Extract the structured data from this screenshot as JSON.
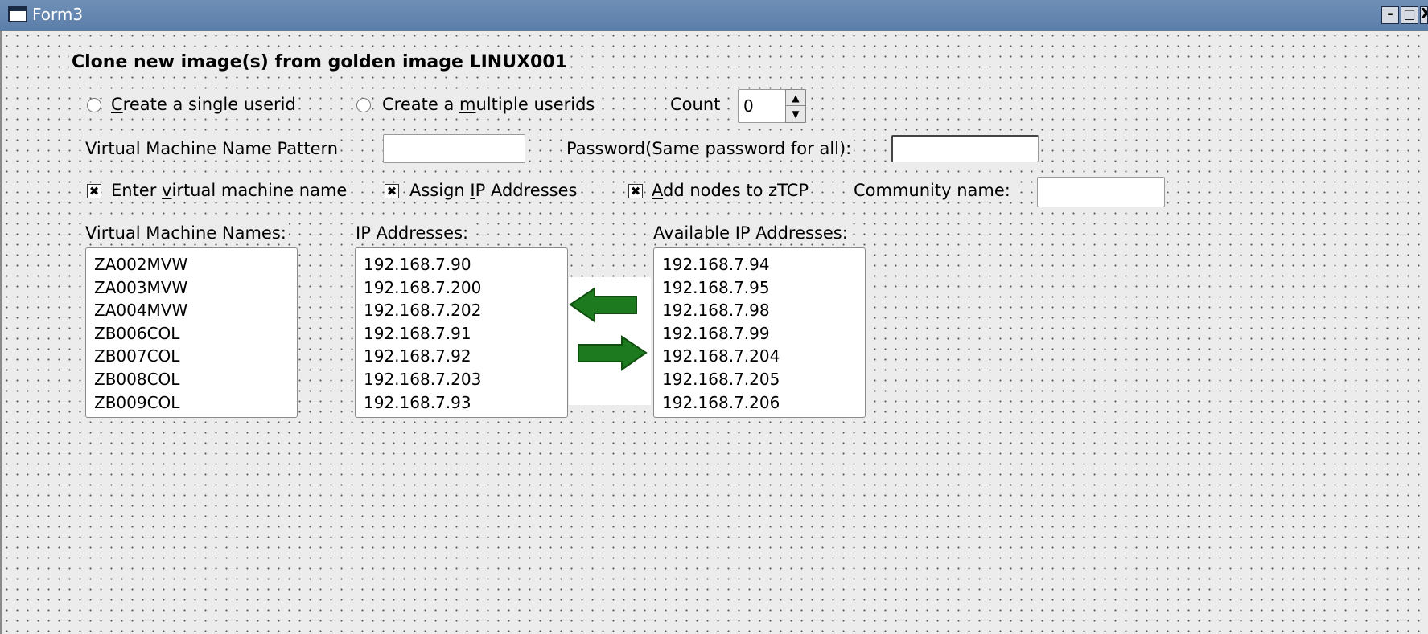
{
  "window": {
    "title": "Form3",
    "minimize_glyph": "-",
    "maximize_glyph": "□",
    "close_glyph": "X"
  },
  "heading": "Clone new image(s) from golden image LINUX001",
  "mode": {
    "single": {
      "label_pre": "",
      "mnemonic": "C",
      "label_post": "reate a single userid",
      "selected": false
    },
    "multiple": {
      "label_pre": "Create a ",
      "mnemonic": "m",
      "label_post": "ultiple userids",
      "selected": false
    }
  },
  "count": {
    "label": "Count",
    "value": "0"
  },
  "vm_name_pattern": {
    "label": "Virtual Machine Name Pattern",
    "value": ""
  },
  "password": {
    "label": "Password(Same password for all):",
    "value": ""
  },
  "options": {
    "enter_vm_name": {
      "label_pre": "Enter ",
      "mnemonic": "v",
      "label_post": "irtual machine name",
      "checked": true
    },
    "assign_ip": {
      "label_pre": "Assign ",
      "mnemonic": "I",
      "label_post": "P Addresses",
      "checked": true
    },
    "add_nodes": {
      "label_pre": "",
      "mnemonic": "A",
      "label_post": "dd nodes to zTCP",
      "checked": true
    }
  },
  "community": {
    "label": "Community name:",
    "value": ""
  },
  "lists": {
    "vm_names": {
      "label": "Virtual Machine Names:",
      "items": [
        "ZA002MVW",
        "ZA003MVW",
        "ZA004MVW",
        "ZB006COL",
        "ZB007COL",
        "ZB008COL",
        "ZB009COL"
      ]
    },
    "ip_addresses": {
      "label": "IP Addresses:",
      "items": [
        "192.168.7.90",
        "192.168.7.200",
        "192.168.7.202",
        "192.168.7.91",
        "192.168.7.92",
        "192.168.7.203",
        "192.168.7.93"
      ]
    },
    "available_ips": {
      "label": "Available IP Addresses:",
      "items": [
        "192.168.7.94",
        "192.168.7.95",
        "192.168.7.98",
        "192.168.7.99",
        "192.168.7.204",
        "192.168.7.205",
        "192.168.7.206"
      ]
    }
  },
  "transfer": {
    "move_left_icon": "green-arrow-left",
    "move_right_icon": "green-arrow-right",
    "arrow_color": "#1e7a1e"
  },
  "check_glyph": "✖"
}
